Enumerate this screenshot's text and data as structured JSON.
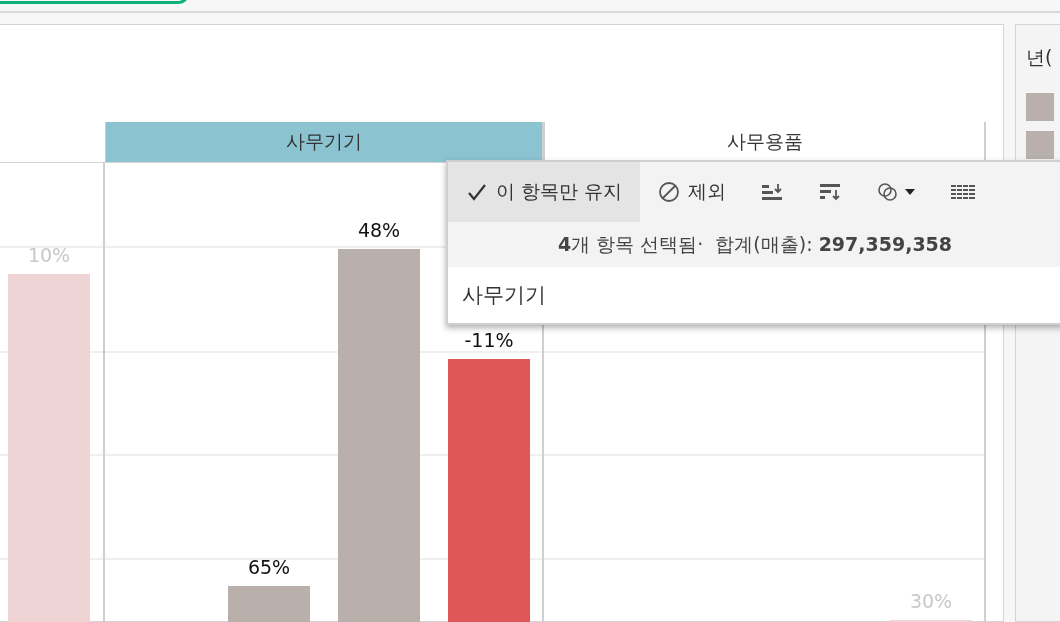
{
  "legend": {
    "title": "년("
  },
  "chart": {
    "panes": [
      {
        "bars": [
          {
            "label": "10%",
            "color": "#efd4d5",
            "selected": false
          }
        ]
      },
      {
        "header": {
          "label": "사무기기",
          "selected": true
        },
        "bars": [
          {
            "label": "65%",
            "color": "#bab0ab",
            "selected": true
          },
          {
            "label": "48%",
            "color": "#bab0ab",
            "selected": true
          },
          {
            "label": "-11%",
            "color": "#e05759",
            "selected": true
          }
        ]
      },
      {
        "header": {
          "label": "사무용품",
          "selected": false
        },
        "bars": [
          {
            "label": "30%",
            "color": "#efd4d5",
            "selected": false
          }
        ]
      }
    ]
  },
  "tooltip": {
    "actions": [
      {
        "kind": "keep",
        "label": "이 항목만 유지",
        "selected": true
      },
      {
        "kind": "exclude",
        "label": "제외",
        "selected": false
      },
      {
        "kind": "sort-asc",
        "selected": false
      },
      {
        "kind": "sort-desc",
        "selected": false
      },
      {
        "kind": "group",
        "selected": false
      },
      {
        "kind": "view-data",
        "selected": false
      }
    ],
    "summary": "**4**개 항목 선택됨·  합계(매출): **297,359,358**",
    "item": "사무기기"
  }
}
